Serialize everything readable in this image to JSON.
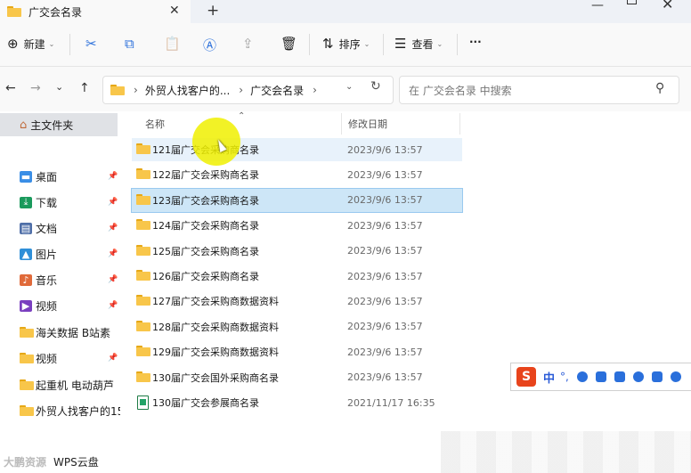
{
  "tab": {
    "title": "广交会名录",
    "close": "✕",
    "new_tab": "+"
  },
  "window": {
    "minimize": "—",
    "close": "✕"
  },
  "toolbar": {
    "new_icon": "⊕",
    "new_label": "新建",
    "new_caret": "⌄",
    "cut_icon": "✂",
    "copy_icon": "⧉",
    "paste_icon": "📋",
    "rename_icon": "Ⓐ",
    "share_icon": "⇪",
    "delete_icon": "🗑",
    "sort_icon": "⇅",
    "sort_label": "排序",
    "sort_caret": "⌄",
    "view_icon": "☰",
    "view_label": "查看",
    "view_caret": "⌄",
    "more_label": "···"
  },
  "nav": {
    "back": "←",
    "forward": "→",
    "recent": "⌄",
    "up": "↑"
  },
  "breadcrumb": {
    "sep": "›",
    "items": [
      "外贸人找客户的...",
      "广交会名录"
    ],
    "dropdown": "⌄",
    "refresh": "↻"
  },
  "search": {
    "placeholder": "在 广交会名录 中搜索",
    "icon": "⚲"
  },
  "sidebar": {
    "home": {
      "icon": "⌂",
      "label": "主文件夹"
    },
    "items": [
      {
        "label": "桌面",
        "icon": "▬",
        "color": "#3a8ee6",
        "pinned": true
      },
      {
        "label": "下载",
        "icon": "⤓",
        "color": "#1a9a5c",
        "pinned": true
      },
      {
        "label": "文档",
        "icon": "▤",
        "color": "#4f6fa8",
        "pinned": true
      },
      {
        "label": "图片",
        "icon": "▲",
        "color": "#2f8fd8",
        "pinned": true
      },
      {
        "label": "音乐",
        "icon": "♪",
        "color": "#e06a3a",
        "pinned": true
      },
      {
        "label": "视频",
        "icon": "▶",
        "color": "#7a3fbf",
        "pinned": true
      },
      {
        "label": "海关数据 B站素",
        "icon": "folder",
        "color": "#f8c64a",
        "pinned": false
      },
      {
        "label": "视频",
        "icon": "folder",
        "color": "#f8c64a",
        "pinned": true
      },
      {
        "label": "起重机 电动葫芦",
        "icon": "folder",
        "color": "#f8c64a",
        "pinned": false
      },
      {
        "label": "外贸人找客户的15",
        "icon": "folder",
        "color": "#f8c64a",
        "pinned": false
      }
    ],
    "pin_glyph": "📌"
  },
  "list": {
    "sort_arrow": "⌃",
    "col_name": "名称",
    "col_date": "修改日期",
    "rows": [
      {
        "name": "121届广交会采购商名录",
        "date": "2023/9/6 13:57",
        "type": "folder"
      },
      {
        "name": "122届广交会采购商名录",
        "date": "2023/9/6 13:57",
        "type": "folder"
      },
      {
        "name": "123届广交会采购商名录",
        "date": "2023/9/6 13:57",
        "type": "folder"
      },
      {
        "name": "124届广交会采购商名录",
        "date": "2023/9/6 13:57",
        "type": "folder"
      },
      {
        "name": "125届广交会采购商名录",
        "date": "2023/9/6 13:57",
        "type": "folder"
      },
      {
        "name": "126届广交会采购商名录",
        "date": "2023/9/6 13:57",
        "type": "folder"
      },
      {
        "name": "127届广交会采购商数据资料",
        "date": "2023/9/6 13:57",
        "type": "folder"
      },
      {
        "name": "128届广交会采购商数据资料",
        "date": "2023/9/6 13:57",
        "type": "folder"
      },
      {
        "name": "129届广交会采购商数据资料",
        "date": "2023/9/6 13:57",
        "type": "folder"
      },
      {
        "name": "130届广交会国外采购商名录",
        "date": "2023/9/6 13:57",
        "type": "folder"
      },
      {
        "name": "130届广交会参展商名录",
        "date": "2021/11/17 16:35",
        "type": "excel"
      }
    ]
  },
  "ime": {
    "logo": "S",
    "lang": "中",
    "punct": "°,"
  },
  "watermark": {
    "logo": "大鹏资源",
    "text": "WPS云盘"
  }
}
